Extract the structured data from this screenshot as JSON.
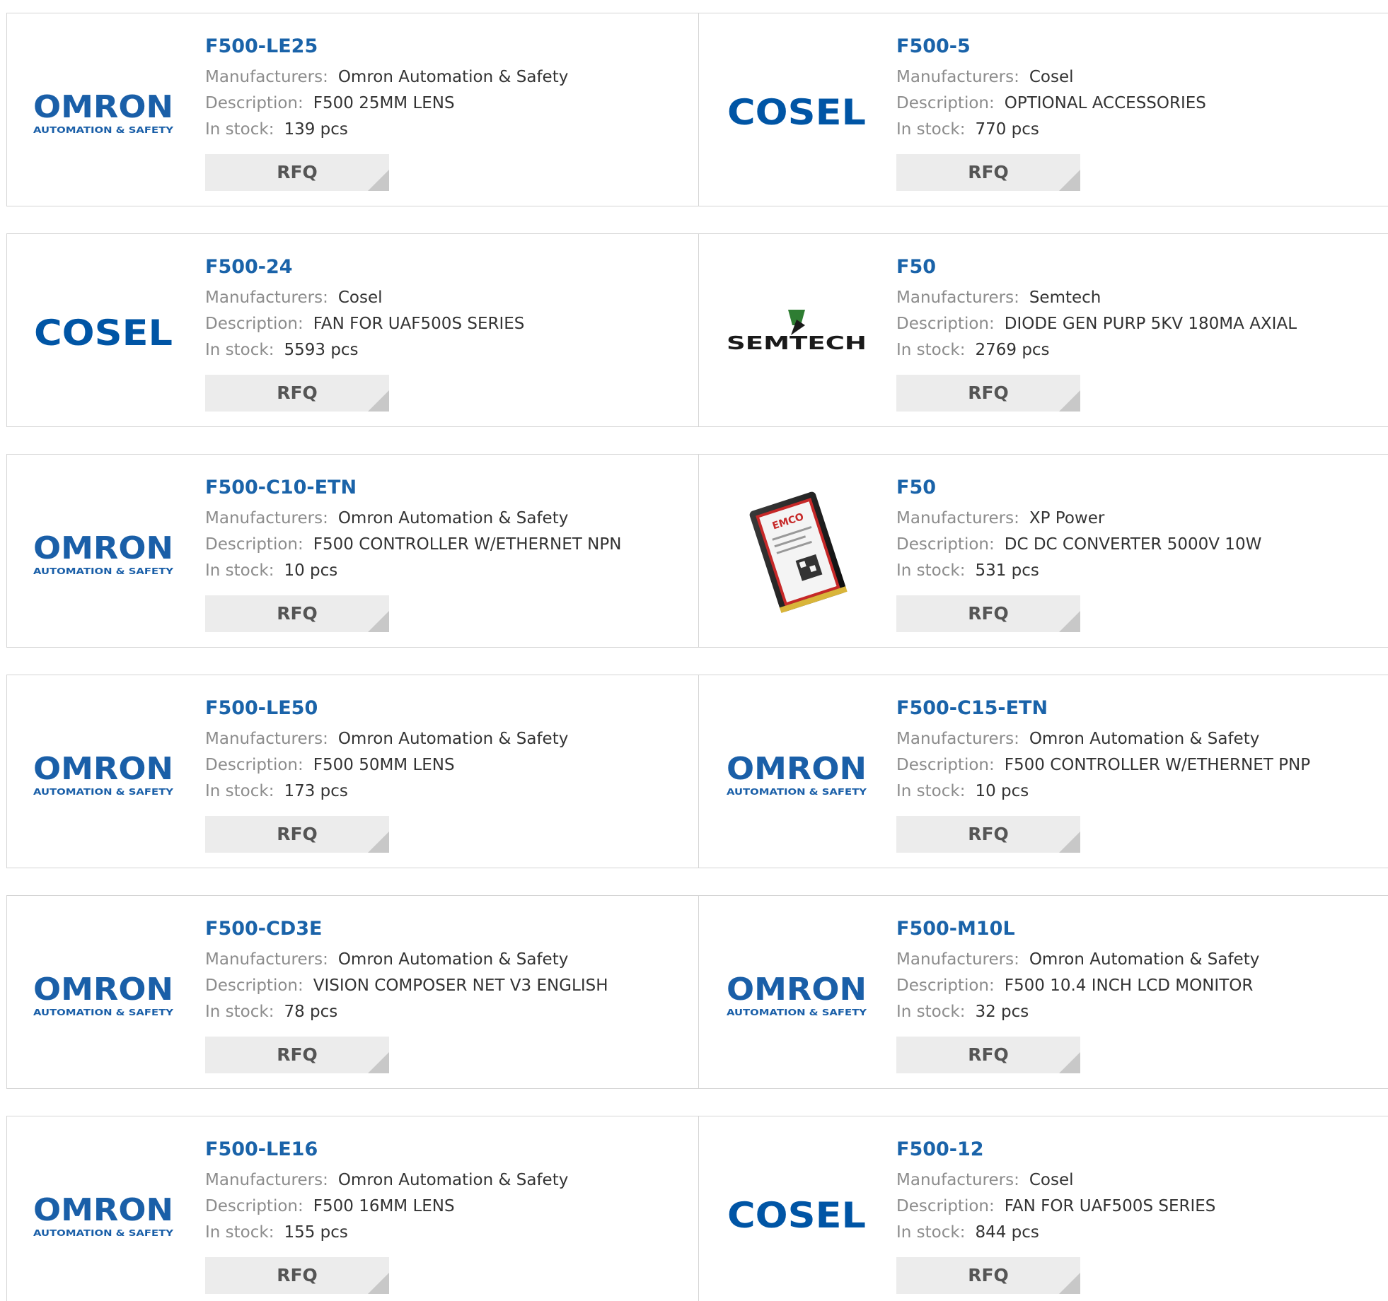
{
  "labels": {
    "manufacturer": "Manufacturers:",
    "description": "Description:",
    "stock": "In stock:",
    "rfq": "RFQ"
  },
  "logos": {
    "omron": {
      "name": "OMRON",
      "tagline": "AUTOMATION & SAFETY",
      "color": "#1a5fa8"
    },
    "cosel": {
      "name": "COSEL",
      "color": "#0055a5"
    },
    "semtech": {
      "name": "SEMTECH",
      "color": "#1a1a1a",
      "accent": "#2e7d32"
    },
    "emco": {
      "label": "EMCO"
    }
  },
  "products": [
    {
      "part": "F500-LE25",
      "manufacturer": "Omron Automation & Safety",
      "description": "F500 25MM LENS",
      "stock": "139 pcs",
      "logo": "omron-logo"
    },
    {
      "part": "F500-5",
      "manufacturer": "Cosel",
      "description": "OPTIONAL ACCESSORIES",
      "stock": "770 pcs",
      "logo": "cosel-logo"
    },
    {
      "part": "F500-24",
      "manufacturer": "Cosel",
      "description": "FAN FOR UAF500S SERIES",
      "stock": "5593 pcs",
      "logo": "cosel-logo"
    },
    {
      "part": "F50",
      "manufacturer": "Semtech",
      "description": "DIODE GEN PURP 5KV 180MA AXIAL",
      "stock": "2769 pcs",
      "logo": "semtech-logo"
    },
    {
      "part": "F500-C10-ETN",
      "manufacturer": "Omron Automation & Safety",
      "description": "F500 CONTROLLER W/ETHERNET NPN",
      "stock": "10 pcs",
      "logo": "omron-logo"
    },
    {
      "part": "F50",
      "manufacturer": "XP Power",
      "description": "DC DC CONVERTER 5000V 10W",
      "stock": "531 pcs",
      "logo": "product-photo"
    },
    {
      "part": "F500-LE50",
      "manufacturer": "Omron Automation & Safety",
      "description": "F500 50MM LENS",
      "stock": "173 pcs",
      "logo": "omron-logo"
    },
    {
      "part": "F500-C15-ETN",
      "manufacturer": "Omron Automation & Safety",
      "description": "F500 CONTROLLER W/ETHERNET PNP",
      "stock": "10 pcs",
      "logo": "omron-logo"
    },
    {
      "part": "F500-CD3E",
      "manufacturer": "Omron Automation & Safety",
      "description": "VISION COMPOSER NET V3 ENGLISH",
      "stock": "78 pcs",
      "logo": "omron-logo"
    },
    {
      "part": "F500-M10L",
      "manufacturer": "Omron Automation & Safety",
      "description": "F500 10.4 INCH LCD MONITOR",
      "stock": "32 pcs",
      "logo": "omron-logo"
    },
    {
      "part": "F500-LE16",
      "manufacturer": "Omron Automation & Safety",
      "description": "F500 16MM LENS",
      "stock": "155 pcs",
      "logo": "omron-logo"
    },
    {
      "part": "F500-12",
      "manufacturer": "Cosel",
      "description": "FAN FOR UAF500S SERIES",
      "stock": "844 pcs",
      "logo": "cosel-logo"
    }
  ]
}
